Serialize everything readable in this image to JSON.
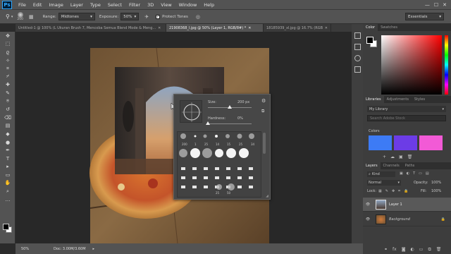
{
  "menubar": {
    "logo": "Ps",
    "items": [
      "File",
      "Edit",
      "Image",
      "Layer",
      "Type",
      "Select",
      "Filter",
      "3D",
      "View",
      "Window",
      "Help"
    ]
  },
  "options": {
    "brush_size": "200",
    "range_label": "Range:",
    "range_value": "Midtones",
    "exposure_label": "Exposure:",
    "exposure_value": "50%",
    "protect_tones": "Protect Tones",
    "workspace": "Essentials"
  },
  "tabs": [
    {
      "label": "Untitled-1 @ 100% (L Ukuran Brush 7, Mencoba Semua Blend Mode & Meng...",
      "active": false
    },
    {
      "label": "21908368_l.jpg @ 50% (Layer 1, RGB/8#) *",
      "active": true
    },
    {
      "label": "18185939_xl.jpg @ 16.7% (RGB/8*)",
      "active": false
    }
  ],
  "tools": [
    "move-icon",
    "marquee-icon",
    "lasso-icon",
    "magic-wand-icon",
    "crop-icon",
    "eyedropper-icon",
    "healing-icon",
    "brush-icon",
    "stamp-icon",
    "history-brush-icon",
    "eraser-icon",
    "gradient-icon",
    "blur-icon",
    "dodge-icon",
    "pen-icon",
    "type-icon",
    "path-select-icon",
    "rectangle-icon",
    "hand-icon",
    "zoom-icon",
    "more-icon"
  ],
  "tool_glyphs": [
    "✥",
    "⬚",
    "ϱ",
    "✧",
    "⌗",
    "⌿",
    "✚",
    "✎",
    "⍟",
    "↺",
    "⌫",
    "▤",
    "◆",
    "●",
    "✒",
    "T",
    "▸",
    "▭",
    "✋",
    "⌕",
    "…"
  ],
  "status": {
    "zoom": "50%",
    "doc": "Doc: 3.00M/3.60M"
  },
  "brush_popup": {
    "size_label": "Size:",
    "size_value": "200 px",
    "hardness_label": "Hardness:",
    "hardness_value": "0%",
    "size_fraction": 0.5,
    "hardness_fraction": 0.0,
    "row1_labels": [
      "200",
      "1",
      "25",
      "14",
      "15",
      "25",
      "34"
    ],
    "row4_labels": [
      "25",
      "50"
    ]
  },
  "color_panel": {
    "tabs": [
      "Color",
      "Swatches"
    ]
  },
  "libraries_panel": {
    "tabs": [
      "Libraries",
      "Adjustments",
      "Styles"
    ],
    "library": "My Library",
    "search_placeholder": "Search Adobe Stock",
    "colors_label": "Colors",
    "colors": [
      "#3d7bf5",
      "#6c3ce6",
      "#f25ad6"
    ]
  },
  "layers_panel": {
    "tabs": [
      "Layers",
      "Channels",
      "Paths"
    ],
    "kind": "Kind",
    "blend_mode": "Normal",
    "opacity_label": "Opacity:",
    "opacity_value": "100%",
    "lock_label": "Lock:",
    "fill_label": "Fill:",
    "fill_value": "100%",
    "layers": [
      "Layer 1",
      "Background"
    ]
  }
}
